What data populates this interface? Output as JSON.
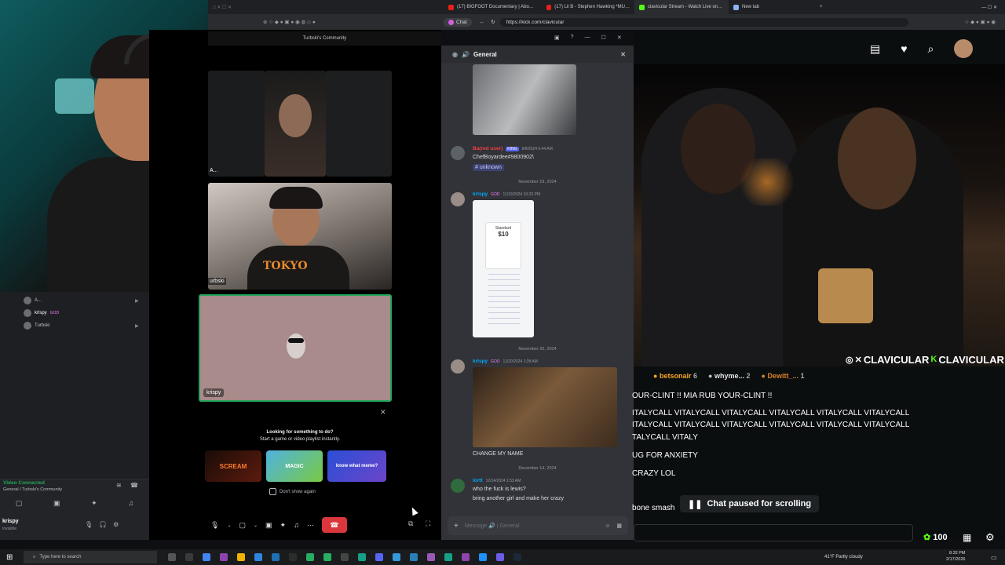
{
  "browser": {
    "tabs": [
      {
        "label": "(17) BIGFOOT Documentary | Abo…",
        "color": "#e62117"
      },
      {
        "label": "(17) Lil B - Stephen Hawking *MU…",
        "color": "#e62117"
      },
      {
        "label": "clavicular Stream - Watch Live on…",
        "color": "#53fc18"
      },
      {
        "label": "New tab",
        "color": "#8ab4f8"
      }
    ],
    "url": "https://kick.com/clavicular",
    "chat_label": "Chat"
  },
  "discord": {
    "server_title": "Turbski's Community",
    "voice_users": [
      {
        "name": "A...",
        "badge": ""
      },
      {
        "name": "krlspy",
        "badge": "GOD"
      },
      {
        "name": "Turbski",
        "badge": ""
      }
    ],
    "video_connected": "Video Connected",
    "voice_path": "General / Turbski's Community",
    "username": "krispy",
    "status": "Invisible",
    "tiles": {
      "tile1_label": "A...",
      "tile2_label": "urbski",
      "tile3_label": "krispy"
    },
    "activity": {
      "title": "Looking for something to do?",
      "subtitle": "Start a game or video playlist instantly.",
      "dont_show": "Don't show again",
      "games": [
        "SCREAM",
        "MAGIC",
        "know what meme?"
      ]
    },
    "channel": {
      "name": "General",
      "messages": [
        {
          "author": "Ba​(red user)",
          "author_color": "#f23f43",
          "badge": "KING",
          "time": "9/8/2024 5:44 AM",
          "lines": [
            "ChefBoyardee#9800902\\",
            "# unknown"
          ]
        },
        {
          "date_sep": "November 19, 2024"
        },
        {
          "author": "krlspy",
          "author_color": "#00a8fc",
          "badge": "GOD",
          "time": "11/19/2024 10:20 PM",
          "lines": []
        },
        {
          "date_sep": "November 20, 2024"
        },
        {
          "author": "krlspy",
          "author_color": "#00a8fc",
          "badge": "GOD",
          "time": "11/20/2024 1:28 AM",
          "lines": [
            "CHANGE MY NAME"
          ]
        },
        {
          "date_sep": "December 14, 2024"
        },
        {
          "author": "lortt",
          "author_color": "#00a8fc",
          "badge": "",
          "time": "12/14/2024 1:53 AM",
          "lines": [
            "who the fuck is lewis?",
            "bring another girl and make her crazy"
          ]
        }
      ],
      "input_placeholder": "Message 🔊 | General",
      "price_card": {
        "plan": "Standard",
        "price": "$10"
      }
    }
  },
  "kick": {
    "overlay_handle": "CLAVICULAR",
    "top_gifters": [
      {
        "name": "betsonair",
        "count": "6",
        "color": "#f5a623"
      },
      {
        "name": "whyme...",
        "count": "2",
        "color": "#c0c0c0"
      },
      {
        "name": "Dewitt_...",
        "count": "1",
        "color": "#d9822b"
      }
    ],
    "chat_lines": [
      "OUR-CLINT !! MIA RUB YOUR-CLINT !!",
      "ITALYCALL VITALYCALL VITALYCALL VITALYCALL VITALYCALL VITALYCALL",
      "ITALYCALL VITALYCALL VITALYCALL VITALYCALL VITALYCALL VITALYCALL",
      "TALYCALL VITALY",
      "UG FOR ANXIETY",
      "CRAZY LOL",
      "bone smash"
    ],
    "paused": "Chat paused for scrolling",
    "points": "100"
  },
  "taskbar": {
    "search_placeholder": "Type here to search",
    "weather": "41°F  Partly cloudy",
    "time": "8:32 PM",
    "date": "2/17/2026"
  }
}
